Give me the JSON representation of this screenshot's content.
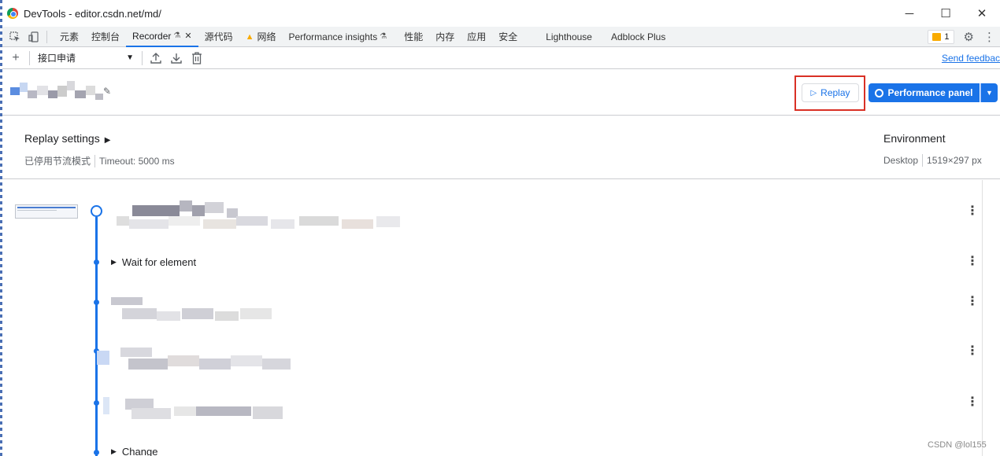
{
  "window": {
    "title": "DevTools - editor.csdn.net/md/",
    "minimize": "─",
    "maximize": "☐",
    "close": "✕"
  },
  "tabs": [
    {
      "label": "元素"
    },
    {
      "label": "控制台"
    },
    {
      "label": "Recorder",
      "active": true,
      "close": "✕"
    },
    {
      "label": "源代码"
    },
    {
      "label": "网络",
      "warning": "▲"
    },
    {
      "label": "Performance insights"
    },
    {
      "label": "性能"
    },
    {
      "label": "内存"
    },
    {
      "label": "应用"
    },
    {
      "label": "安全"
    },
    {
      "label": "Lighthouse"
    },
    {
      "label": "Adblock Plus"
    }
  ],
  "issues": {
    "count": "1"
  },
  "toolbar": {
    "add": "+",
    "recording_select": "接口申请",
    "send_feedback": "Send feedbac"
  },
  "header": {
    "replay_label": "Replay",
    "performance_label": "Performance panel"
  },
  "settings": {
    "title": "Replay settings",
    "throttle": "已停用节流模式",
    "timeout": "Timeout: 5000 ms",
    "env_title": "Environment",
    "env_device": "Desktop",
    "env_size": "1519×297 px"
  },
  "steps": [
    {
      "label": "Wait for element"
    },
    {
      "label": "Change"
    }
  ],
  "watermark": "CSDN @lol155",
  "colors": {
    "accent": "#1a73e8",
    "highlight_outline": "#d93025",
    "warning": "#f9ab00"
  }
}
